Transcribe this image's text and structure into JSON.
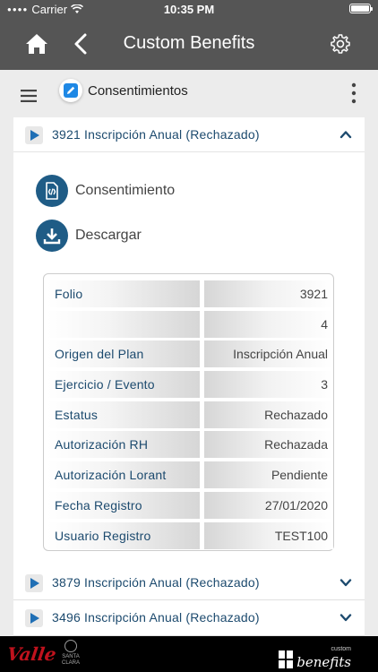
{
  "status_bar": {
    "carrier": "Carrier",
    "time": "10:35 PM"
  },
  "nav": {
    "title": "Custom Benefits"
  },
  "section": {
    "title": "Consentimientos"
  },
  "cards": [
    {
      "title": "3921 Inscripción Anual (Rechazado)",
      "expanded": true,
      "actions": [
        {
          "label": "Consentimiento",
          "icon": "document-signature-icon"
        },
        {
          "label": "Descargar",
          "icon": "download-icon"
        }
      ],
      "details": [
        {
          "label": "Folio",
          "value": "3921"
        },
        {
          "label": "",
          "value": "4"
        },
        {
          "label": "Origen del Plan",
          "value": "Inscripción Anual"
        },
        {
          "label": "Ejercicio / Evento",
          "value": "3"
        },
        {
          "label": "Estatus",
          "value": "Rechazado"
        },
        {
          "label": "Autorización RH",
          "value": "Rechazada"
        },
        {
          "label": "Autorización Lorant",
          "value": "Pendiente"
        },
        {
          "label": "Fecha Registro",
          "value": "27/01/2020"
        },
        {
          "label": "Usuario Registro",
          "value": "TEST100"
        }
      ]
    },
    {
      "title": "3879 Inscripción Anual (Rechazado)",
      "expanded": false
    },
    {
      "title": "3496 Inscripción Anual (Rechazado)",
      "expanded": false
    }
  ],
  "footer": {
    "logo_left": "Valle",
    "logo_center_top": "SANTA",
    "logo_center_bottom": "CLARA",
    "logo_right_top": "custom",
    "logo_right": "benefits"
  },
  "colors": {
    "bar": "#555555",
    "accent": "#1f5c86",
    "label_text": "#1c4a6e",
    "footer": "#000000"
  }
}
